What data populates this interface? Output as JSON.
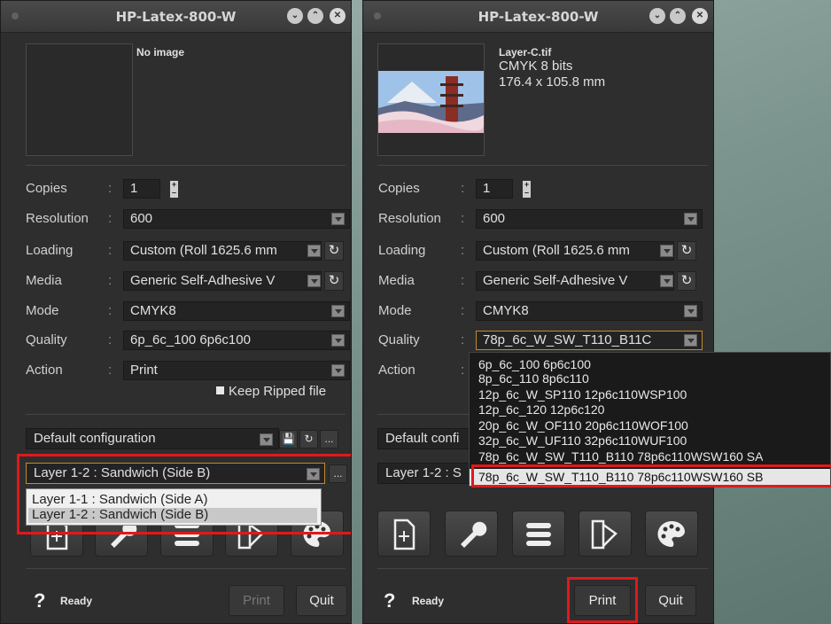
{
  "left_window": {
    "title": "HP-Latex-800-W",
    "no_image": "No image",
    "rows": {
      "copies": {
        "label": "Copies",
        "value": "1"
      },
      "resolution": {
        "label": "Resolution",
        "value": "600"
      },
      "loading": {
        "label": "Loading",
        "value": "Custom (Roll 1625.6 mm"
      },
      "media": {
        "label": "Media",
        "value": "Generic Self-Adhesive V"
      },
      "mode": {
        "label": "Mode",
        "value": "CMYK8"
      },
      "quality": {
        "label": "Quality",
        "value": "6p_6c_100 6p6c100"
      },
      "action": {
        "label": "Action",
        "value": "Print"
      }
    },
    "colon": ":",
    "keep_ripped": "Keep Ripped file",
    "config": "Default configuration",
    "layer": "Layer 1-2 : Sandwich (Side B)",
    "layer_options": [
      "Layer 1-1 : Sandwich (Side A)",
      "Layer 1-2 : Sandwich (Side B)"
    ],
    "more": "...",
    "status": "Ready",
    "help": "?",
    "print": "Print",
    "quit": "Quit"
  },
  "right_window": {
    "title": "HP-Latex-800-W",
    "file_name": "Layer-C.tif",
    "color_mode": "CMYK 8 bits",
    "size": "176.4 x 105.8 mm",
    "rows": {
      "copies": {
        "label": "Copies",
        "value": "1"
      },
      "resolution": {
        "label": "Resolution",
        "value": "600"
      },
      "loading": {
        "label": "Loading",
        "value": "Custom (Roll 1625.6 mm"
      },
      "media": {
        "label": "Media",
        "value": "Generic Self-Adhesive V"
      },
      "mode": {
        "label": "Mode",
        "value": "CMYK8"
      },
      "quality": {
        "label": "Quality",
        "value": "78p_6c_W_SW_T110_B11C"
      },
      "action": {
        "label": "Action",
        "value": ""
      }
    },
    "colon": ":",
    "config": "Default confi",
    "layer": "Layer 1-2 : S",
    "quality_options": [
      "6p_6c_100 6p6c100",
      "8p_6c_110 8p6c110",
      "12p_6c_W_SP110 12p6c110WSP100",
      "12p_6c_120 12p6c120",
      "20p_6c_W_OF110 20p6c110WOF100",
      "32p_6c_W_UF110 32p6c110WUF100",
      "78p_6c_W_SW_T110_B110 78p6c110WSW160 SA"
    ],
    "quality_selected": "78p_6c_W_SW_T110_B110 78p6c110WSW160 SB",
    "status": "Ready",
    "help": "?",
    "print": "Print",
    "quit": "Quit"
  },
  "colors": {
    "highlight": "#e0191c",
    "window_bg": "#2e2e2e"
  }
}
